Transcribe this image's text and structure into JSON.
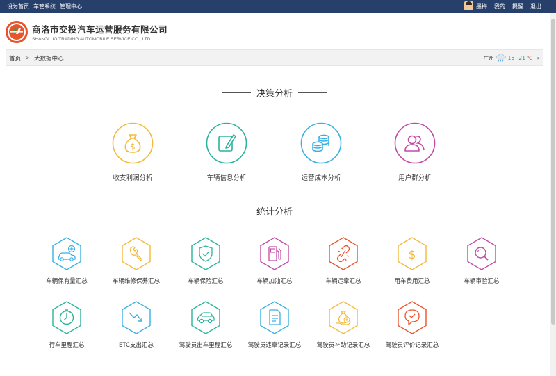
{
  "topbar": {
    "left_links": [
      "设为首页",
      "车管系统",
      "管理中心"
    ],
    "user_name": "墨梅",
    "right_links": [
      "我的",
      "提醒",
      "退出"
    ]
  },
  "brand": {
    "name_cn": "商洛市交投汽车运营服务有限公司",
    "name_en": "SHANGLUO TRADING AUTOMOBILE SERVICE CO., LTD",
    "colors": {
      "primary": "#e8542c",
      "accent": "#2aa54a",
      "topbar": "#27406b"
    }
  },
  "breadcrumb": {
    "home": "首页",
    "separator": ">",
    "current": "大数据中心"
  },
  "weather": {
    "city": "广州",
    "icon": "rain-cloud-icon",
    "temp_range": "16~21",
    "unit": "℃",
    "more": "»"
  },
  "decision": {
    "title": "决策分析",
    "items": [
      {
        "label": "收支利润分析",
        "icon": "money-bag-icon",
        "color": "#f2b93b"
      },
      {
        "label": "车辆信息分析",
        "icon": "edit-note-icon",
        "color": "#2bb39b"
      },
      {
        "label": "运营成本分析",
        "icon": "coin-stack-icon",
        "color": "#3ab0e2"
      },
      {
        "label": "用户群分析",
        "icon": "users-icon",
        "color": "#c14aa5"
      }
    ]
  },
  "statistics": {
    "title": "统计分析",
    "row1": [
      {
        "label": "车辆保有量汇总",
        "icon": "car-add-icon",
        "color": "#3ab0e2"
      },
      {
        "label": "车辆维修保养汇总",
        "icon": "wrench-icon",
        "color": "#f2b93b"
      },
      {
        "label": "车辆保险汇总",
        "icon": "shield-check-icon",
        "color": "#2bb39b"
      },
      {
        "label": "车辆加油汇总",
        "icon": "fuel-pump-icon",
        "color": "#c14aa5"
      },
      {
        "label": "车辆违章汇总",
        "icon": "broken-link-icon",
        "color": "#e8542c"
      },
      {
        "label": "用车费用汇总",
        "icon": "dollar-icon",
        "color": "#f2b93b"
      },
      {
        "label": "车辆审验汇总",
        "icon": "magnifier-icon",
        "color": "#c14aa5"
      }
    ],
    "row2": [
      {
        "label": "行车里程汇总",
        "icon": "speedometer-icon",
        "color": "#2bb39b"
      },
      {
        "label": "ETC支出汇总",
        "icon": "trend-down-icon",
        "color": "#3ab0e2"
      },
      {
        "label": "驾驶员出车里程汇总",
        "icon": "car-icon",
        "color": "#2bb39b"
      },
      {
        "label": "驾驶员违章记录汇总",
        "icon": "document-icon",
        "color": "#3ab0e2"
      },
      {
        "label": "驾驶员补助记录汇总",
        "icon": "money-hand-icon",
        "color": "#f2b93b"
      },
      {
        "label": "驾驶员评价记录汇总",
        "icon": "chat-heart-icon",
        "color": "#e8542c"
      }
    ]
  }
}
